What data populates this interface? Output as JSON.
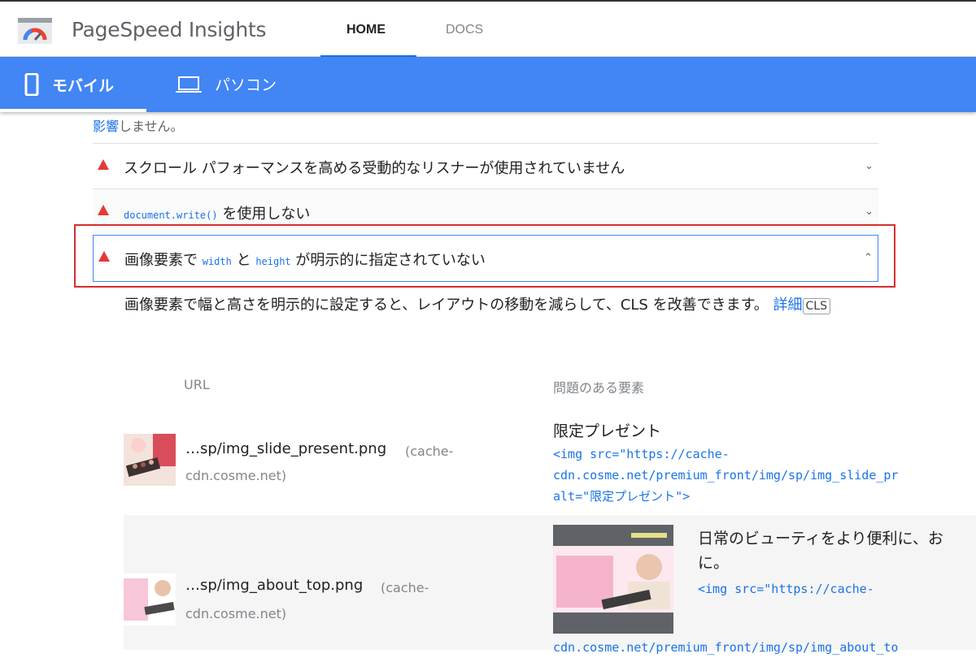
{
  "header": {
    "app_title": "PageSpeed Insights",
    "tabs": [
      {
        "label": "HOME",
        "active": true
      },
      {
        "label": "DOCS",
        "active": false
      }
    ]
  },
  "device_tabs": [
    {
      "label": "モバイル",
      "icon": "smartphone-icon",
      "active": true
    },
    {
      "label": "パソコン",
      "icon": "laptop-icon",
      "active": false
    }
  ],
  "cut_text": {
    "link": "影響",
    "rest": "しません。"
  },
  "audits": [
    {
      "title": "スクロール パフォーマンスを高める受動的なリスナーが使用されていません",
      "expanded": false
    },
    {
      "code": "document.write()",
      "title_rest": " を使用しない",
      "expanded": false
    },
    {
      "pre": "画像要素で ",
      "code1": "width",
      "mid": " と ",
      "code2": "height",
      "post": " が明示的に指定されていない",
      "expanded": true
    }
  ],
  "description": {
    "text": "画像要素で幅と高さを明示的に設定すると、レイアウトの移動を減らして、CLS を改善できます。",
    "link": "詳細",
    "tag": "CLS"
  },
  "table": {
    "headers": [
      "URL",
      "問題のある要素"
    ],
    "rows": [
      {
        "url": "…sp/img_slide_present.png",
        "host_part1": "(cache-",
        "host_part2": "cdn.cosme.net)",
        "element_label": "限定プレゼント",
        "element_code": [
          "<img src=\"https://cache-",
          "cdn.cosme.net/premium_front/img/sp/img_slide_pr",
          "alt=\"限定プレゼント\">"
        ]
      },
      {
        "url": "…sp/img_about_top.png",
        "host_part1": "(cache-",
        "host_part2": "cdn.cosme.net)",
        "element_label_lines": [
          "日常のビューティをより便利に、お",
          "に。"
        ],
        "element_code_line1": "<img src=\"https://cache-",
        "element_code_line2": "cdn.cosme.net/premium_front/img/sp/img_about_to"
      }
    ]
  },
  "colors": {
    "accent": "#4285f4",
    "link": "#1a73e8",
    "fail": "#e53935",
    "highlight_box": "#d32f2f"
  }
}
